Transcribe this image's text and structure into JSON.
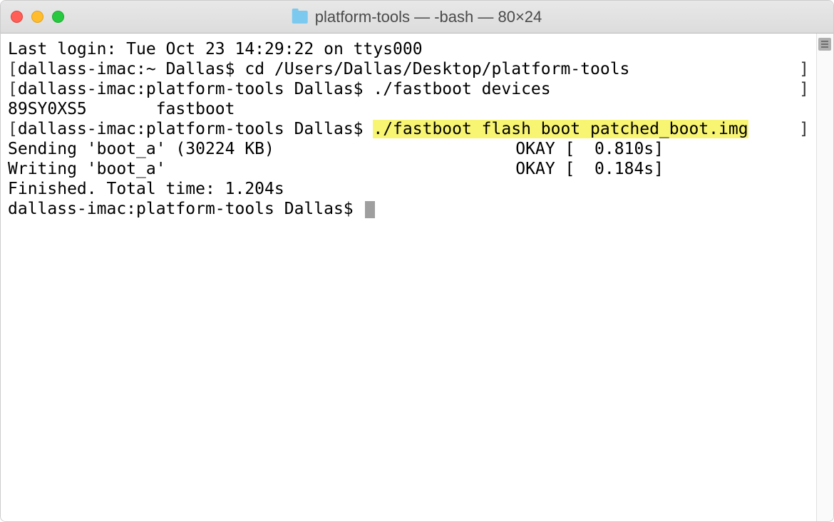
{
  "window": {
    "title": "platform-tools — -bash — 80×24"
  },
  "terminal": {
    "line1": "Last login: Tue Oct 23 14:29:22 on ttys000",
    "line2_prefix": "[",
    "line2_body": "dallass-imac:~ Dallas$ cd /Users/Dallas/Desktop/platform-tools",
    "line2_suffix": "]",
    "line3_prefix": "[",
    "line3_body": "dallass-imac:platform-tools Dallas$ ./fastboot devices",
    "line3_suffix": "]",
    "line4": "89SY0XS5       fastboot",
    "line5_prefix": "[",
    "line5_body_a": "dallass-imac:platform-tools Dallas$ ",
    "line5_body_b": "./fastboot flash boot patched_boot.img",
    "line5_suffix": "]",
    "line6_left": "Sending 'boot_a' (30224 KB)",
    "line6_right": "OKAY [  0.810s]",
    "line7_left": "Writing 'boot_a'",
    "line7_right": "OKAY [  0.184s]",
    "line8": "Finished. Total time: 1.204s",
    "line9": "dallass-imac:platform-tools Dallas$ "
  }
}
